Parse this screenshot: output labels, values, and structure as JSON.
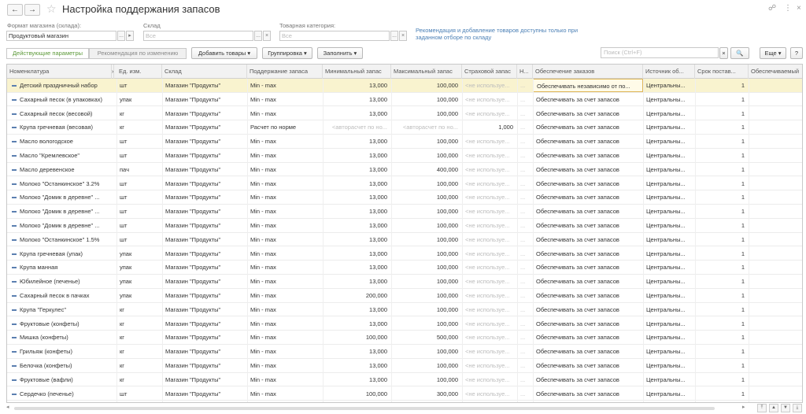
{
  "window": {
    "title": "Настройка поддержания запасов",
    "back_glyph": "←",
    "forward_glyph": "→",
    "star_glyph": "☆",
    "link_glyph": "🔗",
    "more_glyph": "⋮",
    "close_glyph": "×"
  },
  "filters": {
    "store_format": {
      "label": "Формат магазина (склада):",
      "value": "Продуктовый магазин"
    },
    "warehouse": {
      "label": "Склад",
      "placeholder": "Все"
    },
    "category": {
      "label": "Товарная категория:",
      "placeholder": "Все"
    },
    "note": "Рекомендация и добавление товаров доступны только при заданном отборе по складу",
    "btn_select": "...",
    "btn_clear": "×",
    "btn_arrows": "▾"
  },
  "toolbar": {
    "tab_params": "Действующие параметры",
    "tab_recommend": "Рекомендация по изменению",
    "add_goods": "Добавить товары ▾",
    "grouping": "Группировка ▾",
    "fill": "Заполнить ▾",
    "search_placeholder": "Поиск (Ctrl+F)",
    "search_icon": "🔍",
    "more": "Еще ▾",
    "help": "?"
  },
  "table": {
    "headers": {
      "item": "Номенклатура",
      "unit": "Ед. изм.",
      "warehouse": "Склад",
      "method": "Поддержание запаса",
      "min": "Минимальный запас",
      "max": "Максимальный запас",
      "safety": "Страховой запас",
      "h": "Н...",
      "supply": "Обеспечение заказов",
      "source": "Источник об...",
      "lead": "Срок постав...",
      "provided": "Обеспечиваемый"
    },
    "rows": [
      {
        "item": "Детский праздничный набор",
        "unit": "шт",
        "wh": "Магазин \"Продукты\"",
        "method": "Min - max",
        "min": "13,000",
        "max": "100,000",
        "safety": "<не используе...",
        "h": "...",
        "supply": "Обеспечивать независимо от по...",
        "source": "Центральны...",
        "lead": "1"
      },
      {
        "item": "Сахарный песок (в упаковках)",
        "unit": "упак",
        "wh": "Магазин \"Продукты\"",
        "method": "Min - max",
        "min": "13,000",
        "max": "100,000",
        "safety": "<не используе...",
        "h": "...",
        "supply": "Обеспечивать за счет запасов",
        "source": "Центральны...",
        "lead": "1"
      },
      {
        "item": "Сахарный песок (весовой)",
        "unit": "кг",
        "wh": "Магазин \"Продукты\"",
        "method": "Min - max",
        "min": "13,000",
        "max": "100,000",
        "safety": "<не используе...",
        "h": "...",
        "supply": "Обеспечивать за счет запасов",
        "source": "Центральны...",
        "lead": "1"
      },
      {
        "item": "Крупа гречневая (весовая)",
        "unit": "кг",
        "wh": "Магазин \"Продукты\"",
        "method": "Расчет по норме",
        "min": "<авторасчет по но...",
        "max": "<авторасчет по но...",
        "safety": "1,000",
        "h": "...",
        "supply": "Обеспечивать за счет запасов",
        "source": "Центральны...",
        "lead": "1"
      },
      {
        "item": "Масло вологодское",
        "unit": "шт",
        "wh": "Магазин \"Продукты\"",
        "method": "Min - max",
        "min": "13,000",
        "max": "100,000",
        "safety": "<не используе...",
        "h": "...",
        "supply": "Обеспечивать за счет запасов",
        "source": "Центральны...",
        "lead": "1"
      },
      {
        "item": "Масло \"Кремлевское\"",
        "unit": "шт",
        "wh": "Магазин \"Продукты\"",
        "method": "Min - max",
        "min": "13,000",
        "max": "100,000",
        "safety": "<не используе...",
        "h": "...",
        "supply": "Обеспечивать за счет запасов",
        "source": "Центральны...",
        "lead": "1"
      },
      {
        "item": "Масло деревенское",
        "unit": "пач",
        "wh": "Магазин \"Продукты\"",
        "method": "Min - max",
        "min": "13,000",
        "max": "400,000",
        "safety": "<не используе...",
        "h": "...",
        "supply": "Обеспечивать за счет запасов",
        "source": "Центральны...",
        "lead": "1"
      },
      {
        "item": "Молоко \"Останкинское\" 3.2%",
        "unit": "шт",
        "wh": "Магазин \"Продукты\"",
        "method": "Min - max",
        "min": "13,000",
        "max": "100,000",
        "safety": "<не используе...",
        "h": "...",
        "supply": "Обеспечивать за счет запасов",
        "source": "Центральны...",
        "lead": "1"
      },
      {
        "item": "Молоко \"Домик в деревне\" ...",
        "unit": "шт",
        "wh": "Магазин \"Продукты\"",
        "method": "Min - max",
        "min": "13,000",
        "max": "100,000",
        "safety": "<не используе...",
        "h": "...",
        "supply": "Обеспечивать за счет запасов",
        "source": "Центральны...",
        "lead": "1"
      },
      {
        "item": "Молоко \"Домик в деревне\" ...",
        "unit": "шт",
        "wh": "Магазин \"Продукты\"",
        "method": "Min - max",
        "min": "13,000",
        "max": "100,000",
        "safety": "<не используе...",
        "h": "...",
        "supply": "Обеспечивать за счет запасов",
        "source": "Центральны...",
        "lead": "1"
      },
      {
        "item": "Молоко \"Домик в деревне\" ...",
        "unit": "шт",
        "wh": "Магазин \"Продукты\"",
        "method": "Min - max",
        "min": "13,000",
        "max": "100,000",
        "safety": "<не используе...",
        "h": "...",
        "supply": "Обеспечивать за счет запасов",
        "source": "Центральны...",
        "lead": "1"
      },
      {
        "item": "Молоко \"Останкинское\" 1.5%",
        "unit": "шт",
        "wh": "Магазин \"Продукты\"",
        "method": "Min - max",
        "min": "13,000",
        "max": "100,000",
        "safety": "<не используе...",
        "h": "...",
        "supply": "Обеспечивать за счет запасов",
        "source": "Центральны...",
        "lead": "1"
      },
      {
        "item": "Крупа гречневая (упак)",
        "unit": "упак",
        "wh": "Магазин \"Продукты\"",
        "method": "Min - max",
        "min": "13,000",
        "max": "100,000",
        "safety": "<не используе...",
        "h": "...",
        "supply": "Обеспечивать за счет запасов",
        "source": "Центральны...",
        "lead": "1"
      },
      {
        "item": "Крупа манная",
        "unit": "упак",
        "wh": "Магазин \"Продукты\"",
        "method": "Min - max",
        "min": "13,000",
        "max": "100,000",
        "safety": "<не используе...",
        "h": "...",
        "supply": "Обеспечивать за счет запасов",
        "source": "Центральны...",
        "lead": "1"
      },
      {
        "item": "Юбилейное (печенье)",
        "unit": "упак",
        "wh": "Магазин \"Продукты\"",
        "method": "Min - max",
        "min": "13,000",
        "max": "100,000",
        "safety": "<не используе...",
        "h": "...",
        "supply": "Обеспечивать за счет запасов",
        "source": "Центральны...",
        "lead": "1"
      },
      {
        "item": "Сахарный песок в пачках",
        "unit": "упак",
        "wh": "Магазин \"Продукты\"",
        "method": "Min - max",
        "min": "200,000",
        "max": "100,000",
        "safety": "<не используе...",
        "h": "...",
        "supply": "Обеспечивать за счет запасов",
        "source": "Центральны...",
        "lead": "1"
      },
      {
        "item": "Крупа \"Геркулес\"",
        "unit": "кг",
        "wh": "Магазин \"Продукты\"",
        "method": "Min - max",
        "min": "13,000",
        "max": "100,000",
        "safety": "<не используе...",
        "h": "...",
        "supply": "Обеспечивать за счет запасов",
        "source": "Центральны...",
        "lead": "1"
      },
      {
        "item": "Фруктовые (конфеты)",
        "unit": "кг",
        "wh": "Магазин \"Продукты\"",
        "method": "Min - max",
        "min": "13,000",
        "max": "100,000",
        "safety": "<не используе...",
        "h": "...",
        "supply": "Обеспечивать за счет запасов",
        "source": "Центральны...",
        "lead": "1"
      },
      {
        "item": "Мишка (конфеты)",
        "unit": "кг",
        "wh": "Магазин \"Продукты\"",
        "method": "Min - max",
        "min": "100,000",
        "max": "500,000",
        "safety": "<не используе...",
        "h": "...",
        "supply": "Обеспечивать за счет запасов",
        "source": "Центральны...",
        "lead": "1"
      },
      {
        "item": "Грильяж (конфеты)",
        "unit": "кг",
        "wh": "Магазин \"Продукты\"",
        "method": "Min - max",
        "min": "13,000",
        "max": "100,000",
        "safety": "<не используе...",
        "h": "...",
        "supply": "Обеспечивать за счет запасов",
        "source": "Центральны...",
        "lead": "1"
      },
      {
        "item": "Белочка (конфеты)",
        "unit": "кг",
        "wh": "Магазин \"Продукты\"",
        "method": "Min - max",
        "min": "13,000",
        "max": "100,000",
        "safety": "<не используе...",
        "h": "...",
        "supply": "Обеспечивать за счет запасов",
        "source": "Центральны...",
        "lead": "1"
      },
      {
        "item": "Фруктовые (вафли)",
        "unit": "кг",
        "wh": "Магазин \"Продукты\"",
        "method": "Min - max",
        "min": "13,000",
        "max": "100,000",
        "safety": "<не используе...",
        "h": "...",
        "supply": "Обеспечивать за счет запасов",
        "source": "Центральны...",
        "lead": "1"
      },
      {
        "item": "Сердечко (печенье)",
        "unit": "шт",
        "wh": "Магазин \"Продукты\"",
        "method": "Min - max",
        "min": "100,000",
        "max": "300,000",
        "safety": "<не используе...",
        "h": "...",
        "supply": "Обеспечивать за счет запасов",
        "source": "Центральны...",
        "lead": "1"
      }
    ]
  },
  "scroll": {
    "up": "▲",
    "down": "▼",
    "top": "⤒",
    "left": "◂",
    "right": "▸"
  }
}
